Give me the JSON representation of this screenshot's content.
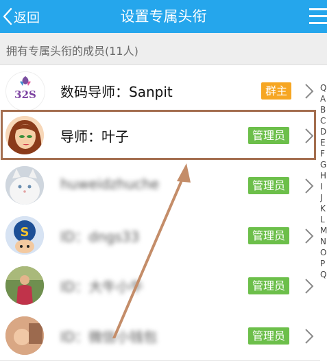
{
  "header": {
    "back_label": "返回",
    "title": "设置专属头衔",
    "menu_icon": "menu-icon"
  },
  "section": {
    "label": "拥有专属头衔的成员(11人)"
  },
  "members": [
    {
      "name": "数码导师：Sanpit",
      "badge": "群主",
      "role": "owner",
      "blurred": false,
      "logo_text": "32S"
    },
    {
      "name": "导师：叶子",
      "badge": "管理员",
      "role": "admin",
      "blurred": false
    },
    {
      "name": "huweidzhuche",
      "badge": "管理员",
      "role": "admin",
      "blurred": true
    },
    {
      "name": "ID：dngs33",
      "badge": "管理员",
      "role": "admin",
      "blurred": true
    },
    {
      "name": "ID：大牛小牛",
      "badge": "管理员",
      "role": "admin",
      "blurred": true
    },
    {
      "name": "ID：微信小钱包",
      "badge": "管理员",
      "role": "admin",
      "blurred": true
    }
  ],
  "index_letters": [
    "Q",
    "A",
    "B",
    "C",
    "D",
    "E",
    "F",
    "G",
    "H",
    "I",
    "J",
    "K",
    "L",
    "M",
    "N",
    "O",
    "P",
    "Q"
  ],
  "colors": {
    "header": "#25a6ec",
    "owner_badge": "#f6a623",
    "admin_badge": "#6cbf4a",
    "highlight_box": "#a46e4f",
    "annotation_arrow": "#c48d69"
  }
}
